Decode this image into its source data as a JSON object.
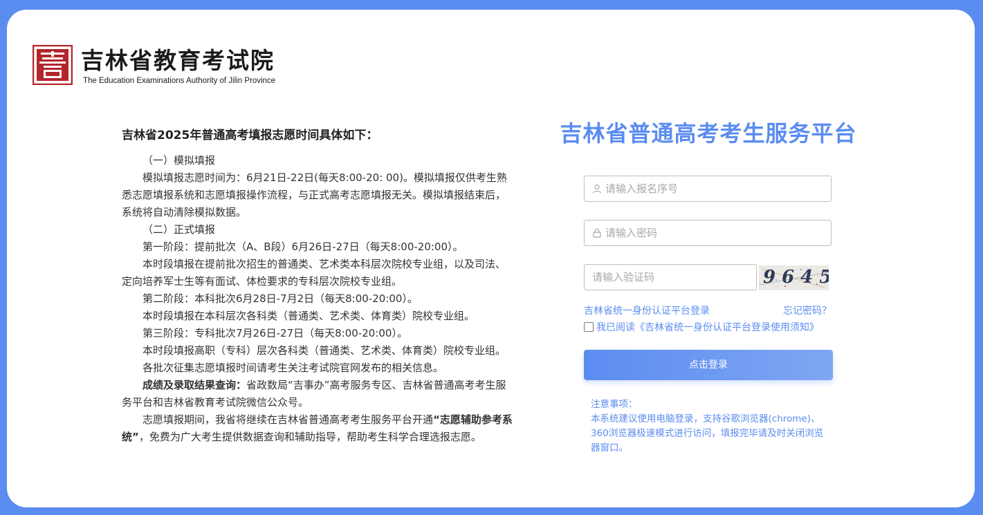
{
  "header": {
    "logo_cn": "吉林省教育考试院",
    "logo_en": "The Education Examinations Authority of Jilin Province"
  },
  "notice": {
    "title": "吉林省2025年普通高考填报志愿时间具体如下：",
    "s1_heading": "（一）模拟填报",
    "s1_text": "模拟填报志愿时间为：6月21日-22日(每天8:00-20: 00)。模拟填报仅供考生熟悉志愿填报系统和志愿填报操作流程，与正式高考志愿填报无关。模拟填报结束后，系统将自动清除模拟数据。",
    "s2_heading": "（二）正式填报",
    "stage1": "第一阶段：提前批次（A、B段）6月26日-27日（每天8:00-20:00）。",
    "stage1_text": "本时段填报在提前批次招生的普通类、艺术类本科层次院校专业组，以及司法、定向培养军士生等有面试、体检要求的专科层次院校专业组。",
    "stage2": "第二阶段：本科批次6月28日-7月2日（每天8:00-20:00）。",
    "stage2_text": "本时段填报在本科层次各科类（普通类、艺术类、体育类）院校专业组。",
    "stage3": "第三阶段：专科批次7月26日-27日（每天8:00-20:00）。",
    "stage3_text": "本时段填报高职（专科）层次各科类（普通类、艺术类、体育类）院校专业组。",
    "collect_text": "各批次征集志愿填报时间请考生关注考试院官网发布的相关信息。",
    "result_label": "成绩及录取结果查询：",
    "result_text": "省政数局“吉事办”高考服务专区、吉林省普通高考考生服务平台和吉林省教育考试院微信公众号。",
    "assist_pre": "志愿填报期间，我省将继续在吉林省普通高考考生服务平台开通",
    "assist_bold": "“志愿辅助参考系统”",
    "assist_post": "，免费为广大考生提供数据查询和辅助指导，帮助考生科学合理选报志愿。"
  },
  "login": {
    "title": "吉林省普通高考考生服务平台",
    "username_placeholder": "请输入报名序号",
    "password_placeholder": "请输入密码",
    "captcha_placeholder": "请输入验证码",
    "captcha_value": "9645",
    "unified_login": "吉林省统一身份认证平台登录",
    "forgot_password": "忘记密码？",
    "agree_text": "我已阅读《吉林省统一身份认证平台登录使用须知》",
    "submit_label": "点击登录"
  },
  "tips": {
    "heading": "注意事项：",
    "text": "本系统建议使用电脑登录，支持谷歌浏览器(chrome)、360浏览器极速模式进行访问，填报完毕请及时关闭浏览器窗口。"
  },
  "colors": {
    "accent": "#5b8cf0",
    "logo_red": "#b3262b"
  }
}
